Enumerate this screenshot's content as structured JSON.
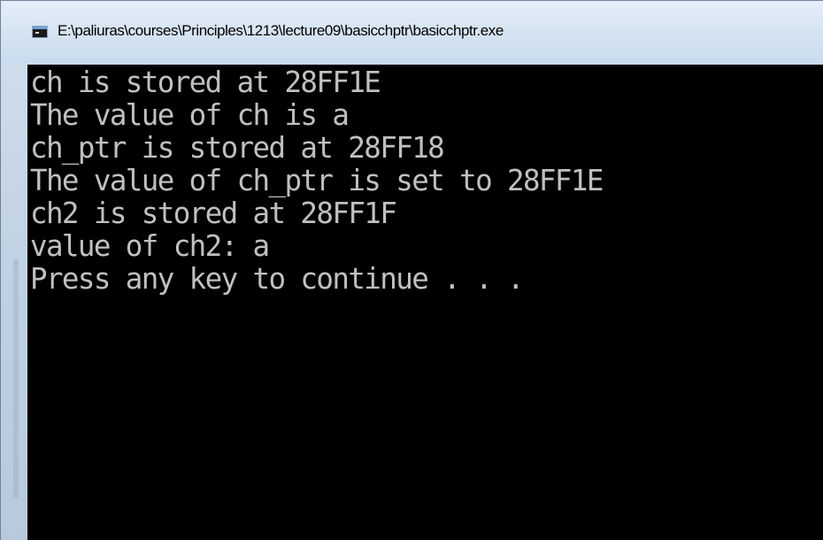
{
  "window": {
    "title": "E:\\paliuras\\courses\\Principles\\1213\\lecture09\\basicchptr\\basicchptr.exe",
    "icon": "console-window-icon"
  },
  "console": {
    "background": "#000000",
    "text_color": "#c0c0c0",
    "lines": [
      "ch is stored at 28FF1E",
      "The value of ch is a",
      "ch_ptr is stored at 28FF18",
      "The value of ch_ptr is set to 28FF1E",
      "ch2 is stored at 28FF1F",
      "value of ch2: a",
      "Press any key to continue . . ."
    ]
  }
}
